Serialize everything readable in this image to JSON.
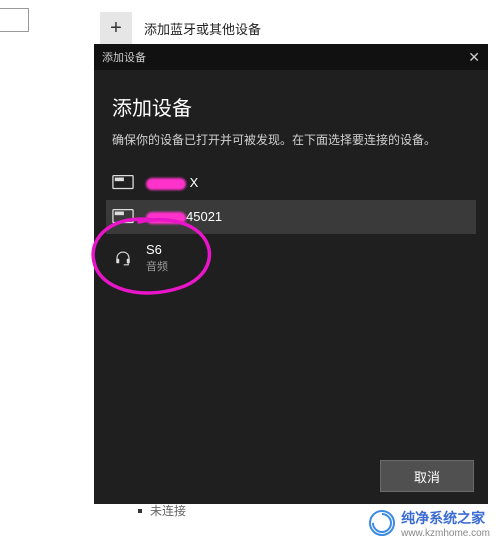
{
  "background": {
    "add_device_label": "添加蓝牙或其他设备",
    "unconnected_label": "未连接"
  },
  "dialog": {
    "titlebar": "添加设备",
    "title": "添加设备",
    "subtitle": "确保你的设备已打开并可被发现。在下面选择要连接的设备。",
    "devices": [
      {
        "name_suffix": " X",
        "subtitle": "",
        "icon": "display",
        "selected": false
      },
      {
        "name_suffix": "45021",
        "subtitle": "",
        "icon": "display",
        "selected": true
      },
      {
        "name": "S6",
        "subtitle": "音频",
        "icon": "headset",
        "selected": false
      }
    ],
    "cancel_label": "取消"
  },
  "watermark": {
    "brand": "纯净系统之家",
    "url": "www.kzmhome.com"
  }
}
